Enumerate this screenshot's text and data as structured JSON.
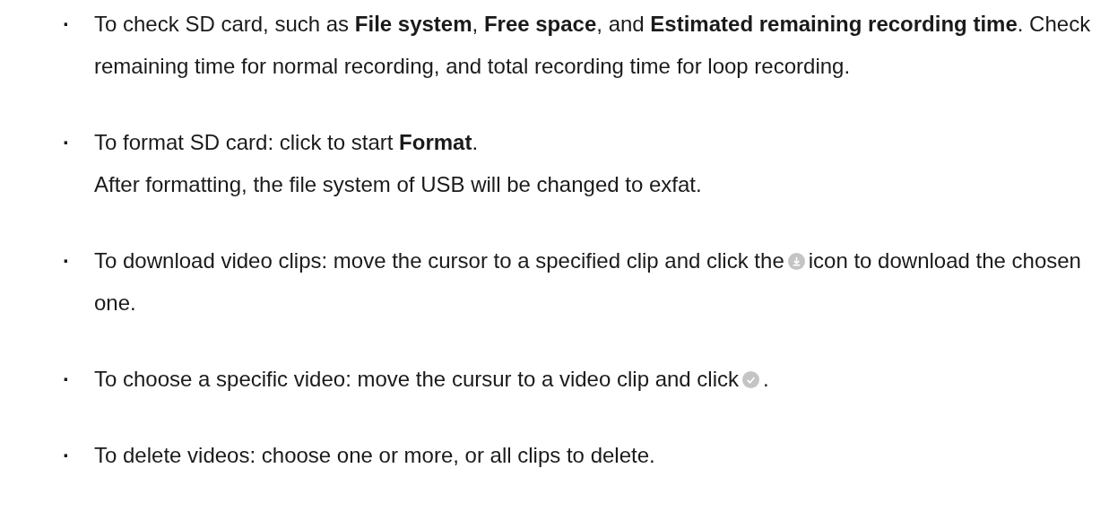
{
  "bullets": [
    {
      "kind": "text",
      "marker": "·",
      "paragraphs": [
        "To check SD card, such as **File system**, **Free space**, and **Estimated remaining recording time**. Check remaining time for normal recording, and total recording time for loop recording."
      ]
    },
    {
      "kind": "text",
      "marker": "·",
      "paragraphs": [
        "To format SD card: click to start **Format**.",
        "After formatting, the file system of USB will be changed to exfat."
      ]
    },
    {
      "kind": "download",
      "marker": "·",
      "before": "To download video clips: move the cursor to a specified clip and click the",
      "after": "icon to download the chosen one."
    },
    {
      "kind": "check",
      "marker": "·",
      "before": "To choose a specific video: move the cursur to a video clip and click",
      "after": "."
    },
    {
      "kind": "text",
      "marker": "·",
      "paragraphs": [
        "To delete videos: choose one or more, or all clips to delete."
      ]
    }
  ]
}
